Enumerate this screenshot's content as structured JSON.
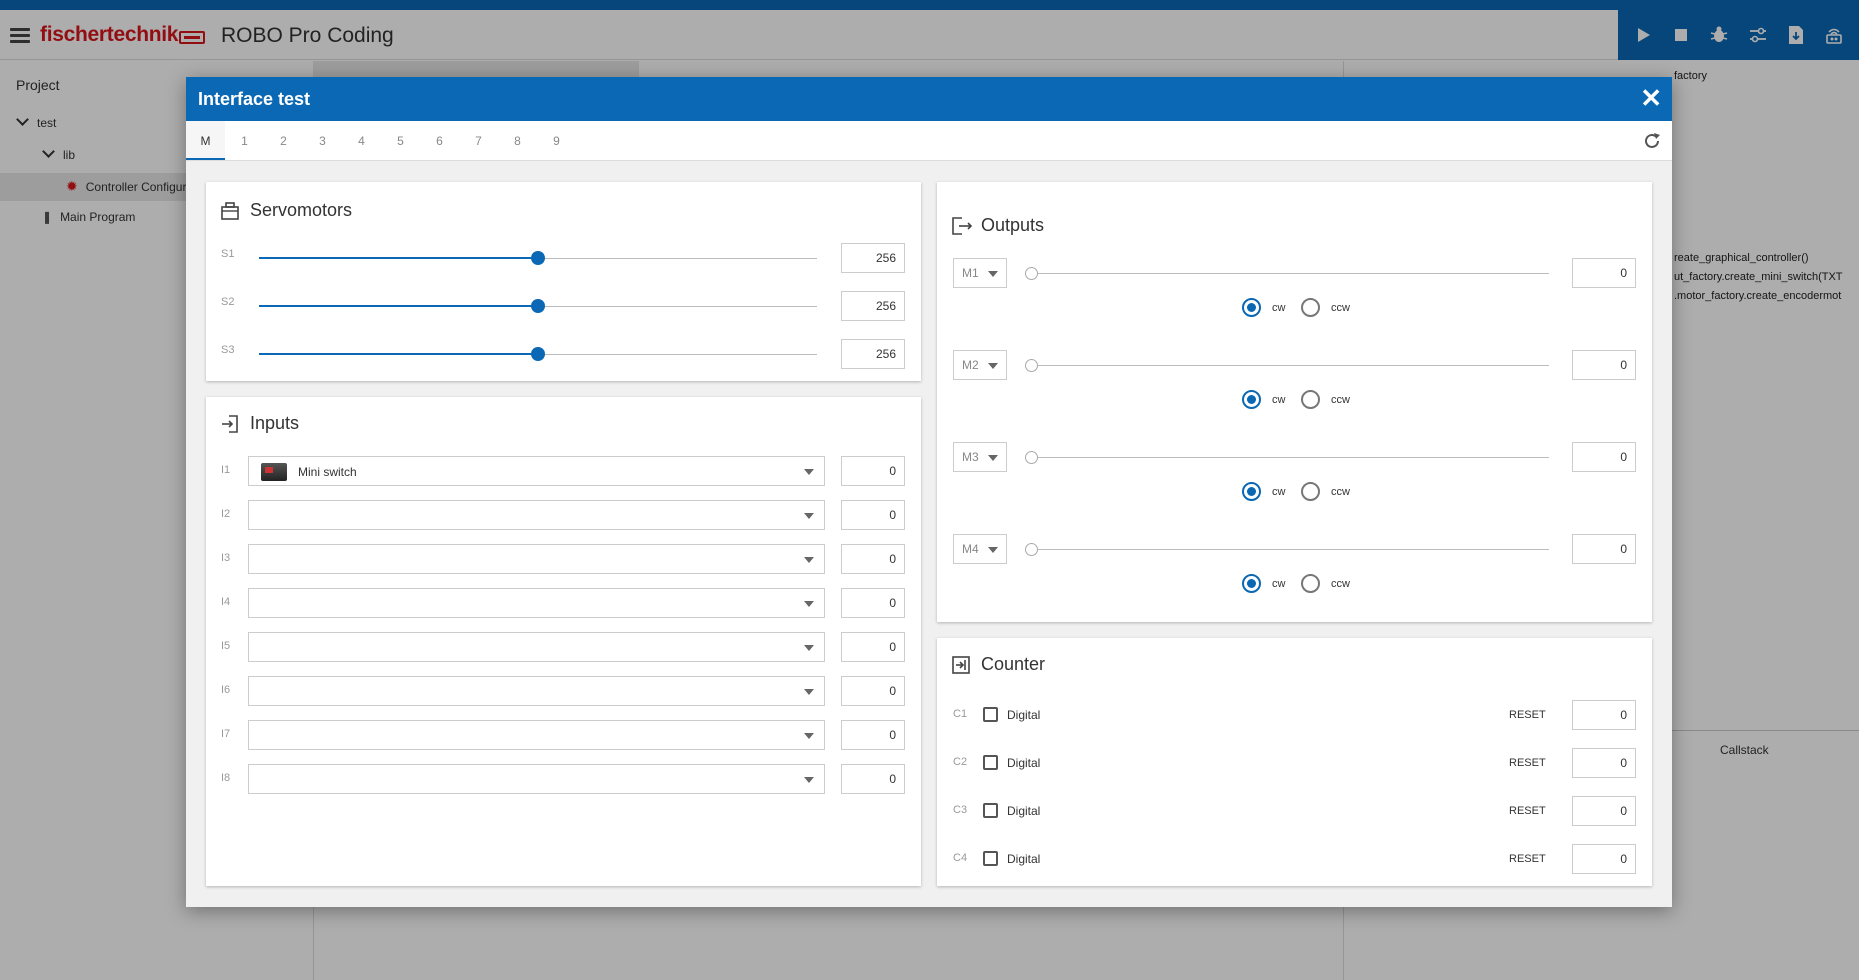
{
  "app": {
    "brand_part1": "fischer",
    "brand_part2": "technik",
    "title": "ROBO Pro Coding"
  },
  "sidebar": {
    "title": "Project",
    "tree": [
      {
        "label": "test"
      },
      {
        "label": "lib"
      },
      {
        "label": "Controller Configur"
      },
      {
        "label": "Main Program"
      }
    ]
  },
  "right_panel": {
    "factory_label": "factory",
    "code_lines": [
      "reate_graphical_controller()",
      "ut_factory.create_mini_switch(TXT",
      ".motor_factory.create_encodermot"
    ],
    "callstack_label": "Callstack"
  },
  "dialog": {
    "title": "Interface test",
    "close_symbol": "✕",
    "tabs": [
      "M",
      "1",
      "2",
      "3",
      "4",
      "5",
      "6",
      "7",
      "8",
      "9"
    ],
    "active_tab": "M"
  },
  "servomotors": {
    "title": "Servomotors",
    "max": 512,
    "items": [
      {
        "label": "S1",
        "value": "256",
        "level": 0.5
      },
      {
        "label": "S2",
        "value": "256",
        "level": 0.5
      },
      {
        "label": "S3",
        "value": "256",
        "level": 0.5
      }
    ]
  },
  "inputs": {
    "title": "Inputs",
    "items": [
      {
        "label": "I1",
        "selected": "Mini switch",
        "value": "0"
      },
      {
        "label": "I2",
        "selected": "",
        "value": "0"
      },
      {
        "label": "I3",
        "selected": "",
        "value": "0"
      },
      {
        "label": "I4",
        "selected": "",
        "value": "0"
      },
      {
        "label": "I5",
        "selected": "",
        "value": "0"
      },
      {
        "label": "I6",
        "selected": "",
        "value": "0"
      },
      {
        "label": "I7",
        "selected": "",
        "value": "0"
      },
      {
        "label": "I8",
        "selected": "",
        "value": "0"
      }
    ]
  },
  "outputs": {
    "title": "Outputs",
    "cw_label": "cw",
    "ccw_label": "ccw",
    "items": [
      {
        "label": "M1",
        "value": "0",
        "direction": "cw",
        "level": 0
      },
      {
        "label": "M2",
        "value": "0",
        "direction": "cw",
        "level": 0
      },
      {
        "label": "M3",
        "value": "0",
        "direction": "cw",
        "level": 0
      },
      {
        "label": "M4",
        "value": "0",
        "direction": "cw",
        "level": 0
      }
    ]
  },
  "counter": {
    "title": "Counter",
    "digital_label": "Digital",
    "reset_label": "RESET",
    "items": [
      {
        "label": "C1",
        "value": "0",
        "checked": false
      },
      {
        "label": "C2",
        "value": "0",
        "checked": false
      },
      {
        "label": "C3",
        "value": "0",
        "checked": false
      },
      {
        "label": "C4",
        "value": "0",
        "checked": false
      }
    ]
  },
  "colors": {
    "accent": "#0a68b4",
    "brand_red": "#d9151c"
  }
}
